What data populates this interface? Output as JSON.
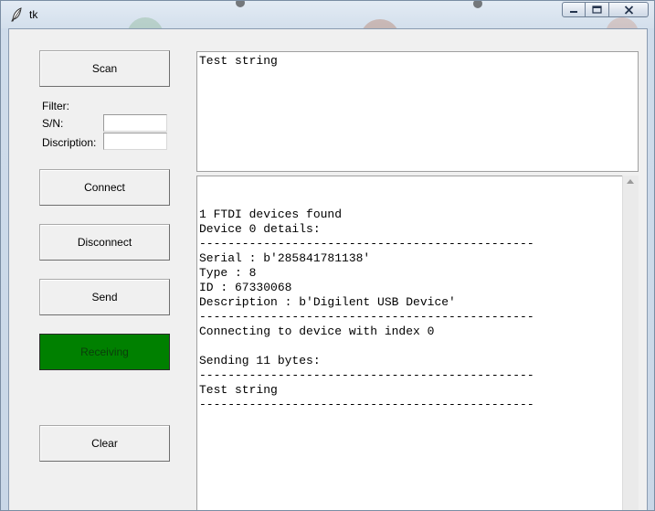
{
  "window": {
    "title": "tk"
  },
  "buttons": {
    "scan": "Scan",
    "connect": "Connect",
    "disconnect": "Disconnect",
    "send": "Send",
    "receiving": "Receiving",
    "clear": "Clear"
  },
  "filter": {
    "heading": "Filter:",
    "sn_label": "S/N:",
    "sn_value": "",
    "description_label": "Discription:",
    "description_value": ""
  },
  "send_text": "Test string",
  "log_lines": [
    "1 FTDI devices found",
    "Device 0 details:",
    "-----------------------------------------------",
    "Serial : b'285841781138'",
    "Type : 8",
    "ID : 67330068",
    "Description : b'Digilent USB Device'",
    "-----------------------------------------------",
    "Connecting to device with index 0",
    "",
    "Sending 11 bytes:",
    "-----------------------------------------------",
    "Test string",
    "-----------------------------------------------"
  ],
  "colors": {
    "receiving_button": "#008000",
    "client_background": "#f0f0f0"
  },
  "icons": {
    "app": "feather-icon",
    "minimize": "minimize-icon",
    "maximize": "maximize-icon",
    "close": "close-icon",
    "scroll_up": "scroll-up-arrow-icon"
  }
}
